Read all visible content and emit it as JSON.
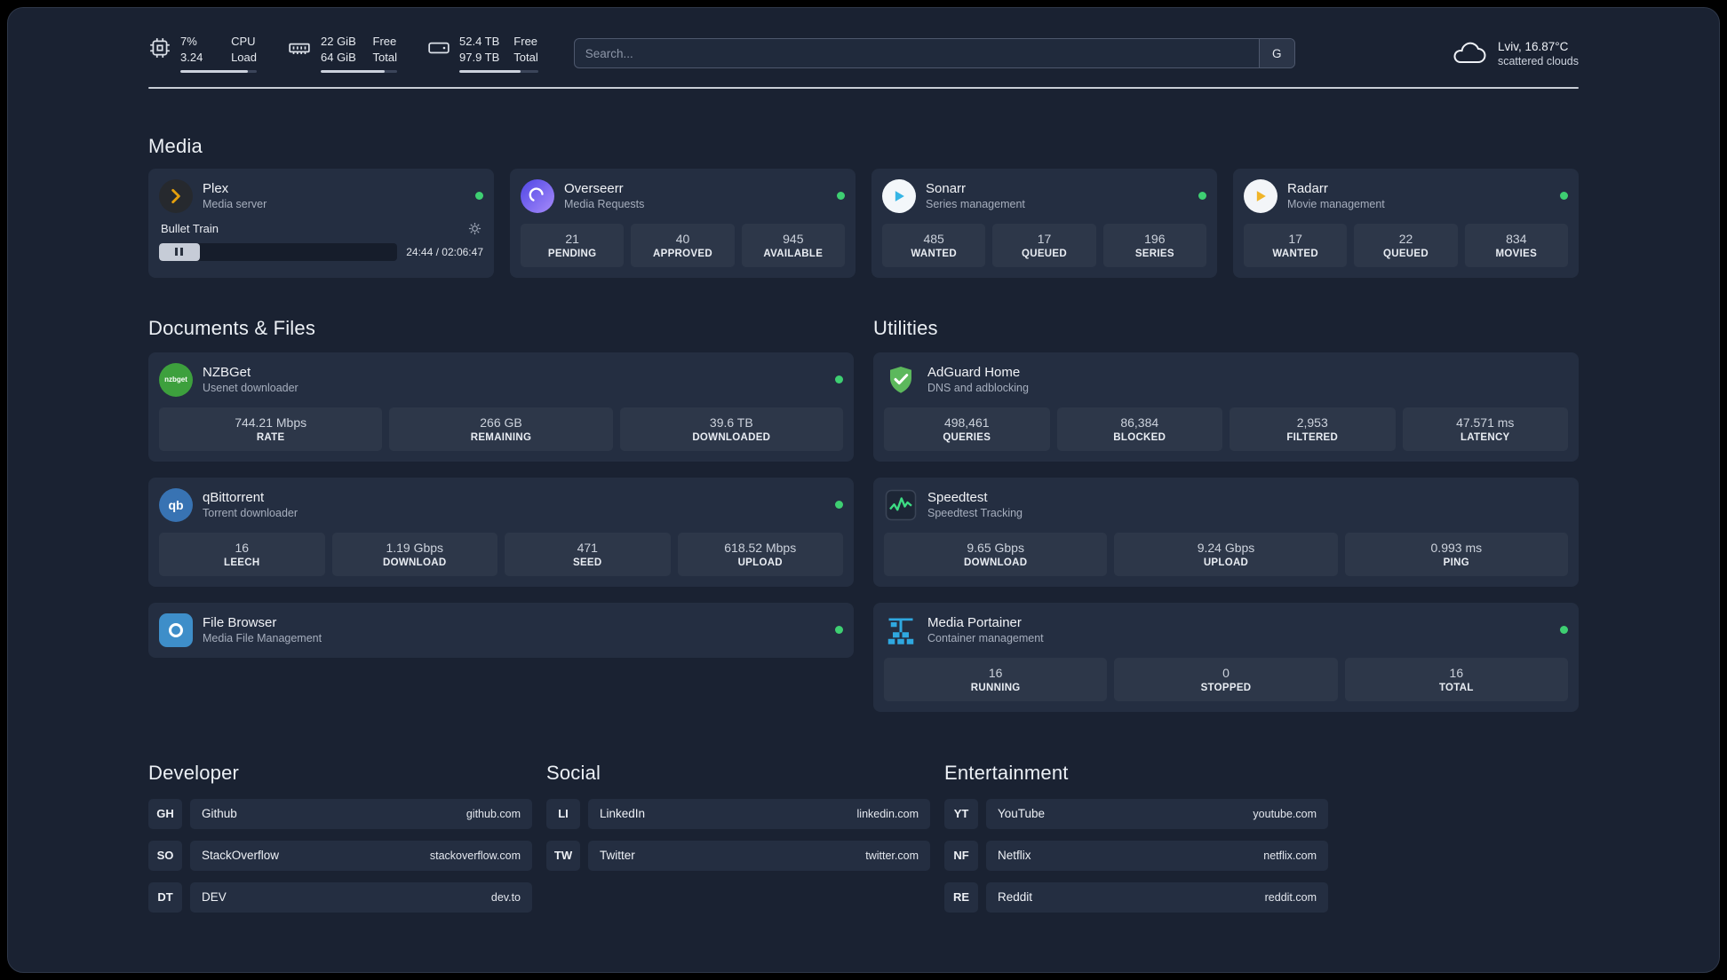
{
  "header": {
    "cpu": {
      "value_top": "7%",
      "value_bottom": "3.24",
      "label_top": "CPU",
      "label_bottom": "Load",
      "bar_percent": 88
    },
    "ram": {
      "value_top": "22 GiB",
      "value_bottom": "64 GiB",
      "label_top": "Free",
      "label_bottom": "Total",
      "bar_percent": 84
    },
    "disk": {
      "value_top": "52.4 TB",
      "value_bottom": "97.9 TB",
      "label_top": "Free",
      "label_bottom": "Total",
      "bar_percent": 78
    },
    "search": {
      "placeholder": "Search...",
      "engine_button": "G"
    },
    "weather": {
      "location": "Lviv, 16.87°C",
      "condition": "scattered clouds"
    }
  },
  "sections": {
    "media": {
      "title": "Media"
    },
    "documents": {
      "title": "Documents & Files"
    },
    "utilities": {
      "title": "Utilities"
    }
  },
  "apps": {
    "plex": {
      "name": "Plex",
      "subtitle": "Media server",
      "now_playing": "Bullet Train",
      "time": "24:44 / 02:06:47",
      "progress_percent": 17
    },
    "overseerr": {
      "name": "Overseerr",
      "subtitle": "Media Requests",
      "stats": [
        {
          "value": "21",
          "label": "PENDING"
        },
        {
          "value": "40",
          "label": "APPROVED"
        },
        {
          "value": "945",
          "label": "AVAILABLE"
        }
      ]
    },
    "sonarr": {
      "name": "Sonarr",
      "subtitle": "Series management",
      "stats": [
        {
          "value": "485",
          "label": "WANTED"
        },
        {
          "value": "17",
          "label": "QUEUED"
        },
        {
          "value": "196",
          "label": "SERIES"
        }
      ]
    },
    "radarr": {
      "name": "Radarr",
      "subtitle": "Movie management",
      "stats": [
        {
          "value": "17",
          "label": "WANTED"
        },
        {
          "value": "22",
          "label": "QUEUED"
        },
        {
          "value": "834",
          "label": "MOVIES"
        }
      ]
    },
    "nzbget": {
      "name": "NZBGet",
      "subtitle": "Usenet downloader",
      "icon_text": "nzbget",
      "stats": [
        {
          "value": "744.21 Mbps",
          "label": "RATE"
        },
        {
          "value": "266 GB",
          "label": "REMAINING"
        },
        {
          "value": "39.6 TB",
          "label": "DOWNLOADED"
        }
      ]
    },
    "qbittorrent": {
      "name": "qBittorrent",
      "subtitle": "Torrent downloader",
      "icon_text": "qb",
      "stats": [
        {
          "value": "16",
          "label": "LEECH"
        },
        {
          "value": "1.19 Gbps",
          "label": "DOWNLOAD"
        },
        {
          "value": "471",
          "label": "SEED"
        },
        {
          "value": "618.52 Mbps",
          "label": "UPLOAD"
        }
      ]
    },
    "filebrowser": {
      "name": "File Browser",
      "subtitle": "Media File Management"
    },
    "adguard": {
      "name": "AdGuard Home",
      "subtitle": "DNS and adblocking",
      "stats": [
        {
          "value": "498,461",
          "label": "QUERIES"
        },
        {
          "value": "86,384",
          "label": "BLOCKED"
        },
        {
          "value": "2,953",
          "label": "FILTERED"
        },
        {
          "value": "47.571 ms",
          "label": "LATENCY"
        }
      ]
    },
    "speedtest": {
      "name": "Speedtest",
      "subtitle": "Speedtest Tracking",
      "stats": [
        {
          "value": "9.65 Gbps",
          "label": "DOWNLOAD"
        },
        {
          "value": "9.24 Gbps",
          "label": "UPLOAD"
        },
        {
          "value": "0.993 ms",
          "label": "PING"
        }
      ]
    },
    "portainer": {
      "name": "Media Portainer",
      "subtitle": "Container management",
      "stats": [
        {
          "value": "16",
          "label": "RUNNING"
        },
        {
          "value": "0",
          "label": "STOPPED"
        },
        {
          "value": "16",
          "label": "TOTAL"
        }
      ]
    }
  },
  "links": {
    "developer": {
      "title": "Developer",
      "items": [
        {
          "abbr": "GH",
          "name": "Github",
          "url": "github.com"
        },
        {
          "abbr": "SO",
          "name": "StackOverflow",
          "url": "stackoverflow.com"
        },
        {
          "abbr": "DT",
          "name": "DEV",
          "url": "dev.to"
        }
      ]
    },
    "social": {
      "title": "Social",
      "items": [
        {
          "abbr": "LI",
          "name": "LinkedIn",
          "url": "linkedin.com"
        },
        {
          "abbr": "TW",
          "name": "Twitter",
          "url": "twitter.com"
        }
      ]
    },
    "entertainment": {
      "title": "Entertainment",
      "items": [
        {
          "abbr": "YT",
          "name": "YouTube",
          "url": "youtube.com"
        },
        {
          "abbr": "NF",
          "name": "Netflix",
          "url": "netflix.com"
        },
        {
          "abbr": "RE",
          "name": "Reddit",
          "url": "reddit.com"
        }
      ]
    }
  }
}
